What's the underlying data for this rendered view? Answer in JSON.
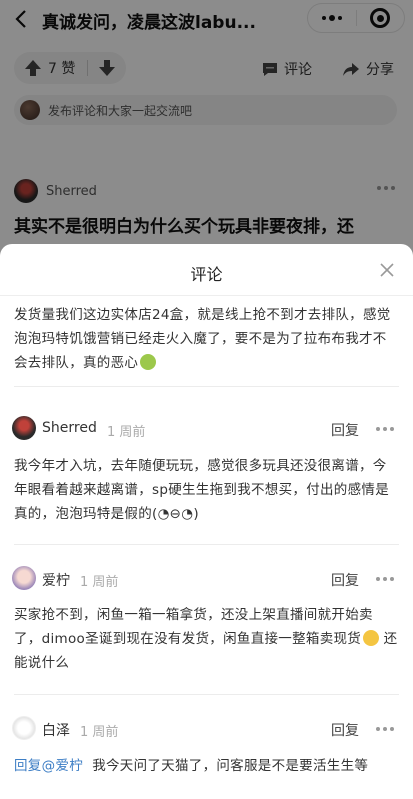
{
  "nav": {
    "title": "真诚发问，凌晨这波labu..."
  },
  "actions": {
    "vote_count": "7 赞",
    "comment_label": "评论",
    "share_label": "分享"
  },
  "comment_input": {
    "placeholder": "发布评论和大家一起交流吧"
  },
  "post": {
    "author": "Sherred",
    "text": "其实不是很明白为什么买个玩具非要夜排，还"
  },
  "sheet": {
    "title": "评论",
    "top_comment_text": "发货量我们这边实体店24盒，就是线上抢不到才去排队，感觉泡泡玛特饥饿营销已经走火入魔了，要不是为了拉布布我才不会去排队，真的恶心",
    "comments": [
      {
        "user": "Sherred",
        "time": "1 周前",
        "reply_label": "回复",
        "text": "我今年才入坑，去年随便玩玩，感觉很多玩具还没很离谱，今年眼看着越来越离谱，sp硬生生拖到我不想买，付出的感情是真的，泡泡玛特是假的(◔⊖◔)"
      },
      {
        "user": "爱柠",
        "time": "1 周前",
        "reply_label": "回复",
        "text": "买家抢不到，闲鱼一箱一箱拿货，还没上架直播间就开始卖了，dimoo圣诞到现在没有发货，闲鱼直接一整箱卖现货",
        "text_after_emoji": " 还能说什么"
      },
      {
        "user": "白泽",
        "time": "1 周前",
        "reply_label": "回复",
        "reply_to": "回复@爱柠",
        "text": "我今天问了天猫了，问客服是不是要活生生等"
      }
    ]
  }
}
